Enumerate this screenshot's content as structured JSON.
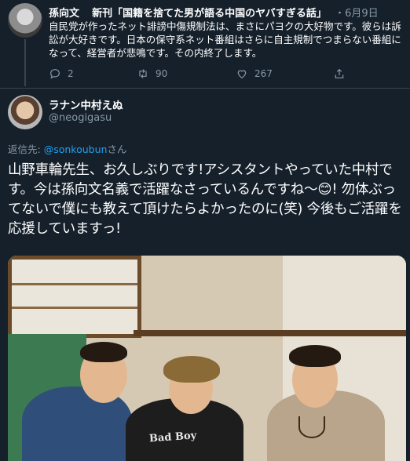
{
  "quoted_tweet": {
    "author": "孫向文",
    "title": "新刊「国籍を捨てた男が語る中国のヤバすぎる話」",
    "separator": "・",
    "date": "6月9日",
    "text": "自民党が作ったネット誹謗中傷規制法は、まさにパヨクの大好物です。彼らは訴訟が大好きです。日本の保守系ネット番組はさらに自主規制でつまらない番組になって、経営者が悲鳴です。その内終了します。",
    "actions": {
      "reply_count": "2",
      "retweet_count": "90",
      "like_count": "267"
    }
  },
  "main_tweet": {
    "display_name": "ラナン中村えぬ",
    "handle": "@neogigasu",
    "reply_prefix": "返信先: ",
    "reply_mention": "@sonkoubun",
    "reply_suffix": "さん",
    "text": "山野車輪先生、お久しぶりです!アシスタントやっていた中村です。今は孫向文名義で活躍なさっているんですね〜😊! 勿体ぶってないで僕にも教えて頂けたらよかったのに(笑) 今後もご活躍を応援していますっ!",
    "photo_text": "Bad Boy"
  },
  "colors": {
    "background": "#15202b",
    "secondary_text": "#8899a6",
    "link": "#1da1f2",
    "divider": "#38444d"
  }
}
